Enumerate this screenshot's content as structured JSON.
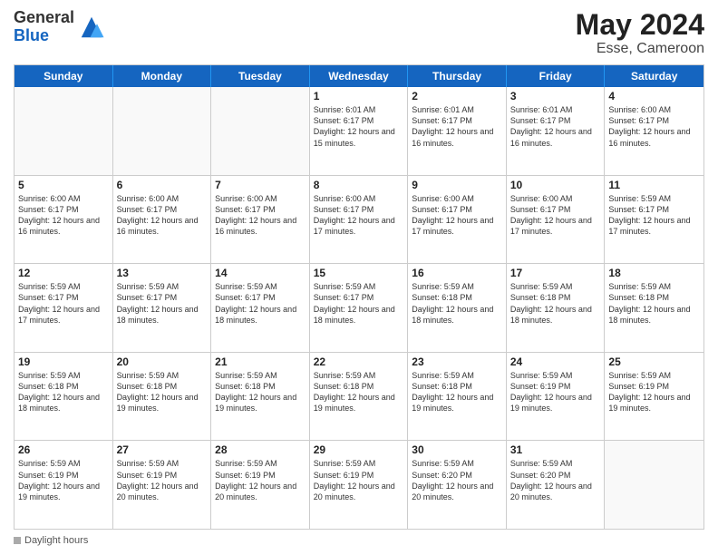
{
  "header": {
    "logo_line1": "General",
    "logo_line2": "Blue",
    "month_year": "May 2024",
    "location": "Esse, Cameroon"
  },
  "weekdays": [
    "Sunday",
    "Monday",
    "Tuesday",
    "Wednesday",
    "Thursday",
    "Friday",
    "Saturday"
  ],
  "rows": [
    [
      {
        "day": "",
        "text": "",
        "empty": true
      },
      {
        "day": "",
        "text": "",
        "empty": true
      },
      {
        "day": "",
        "text": "",
        "empty": true
      },
      {
        "day": "1",
        "text": "Sunrise: 6:01 AM\nSunset: 6:17 PM\nDaylight: 12 hours\nand 15 minutes.",
        "empty": false
      },
      {
        "day": "2",
        "text": "Sunrise: 6:01 AM\nSunset: 6:17 PM\nDaylight: 12 hours\nand 16 minutes.",
        "empty": false
      },
      {
        "day": "3",
        "text": "Sunrise: 6:01 AM\nSunset: 6:17 PM\nDaylight: 12 hours\nand 16 minutes.",
        "empty": false
      },
      {
        "day": "4",
        "text": "Sunrise: 6:00 AM\nSunset: 6:17 PM\nDaylight: 12 hours\nand 16 minutes.",
        "empty": false
      }
    ],
    [
      {
        "day": "5",
        "text": "Sunrise: 6:00 AM\nSunset: 6:17 PM\nDaylight: 12 hours\nand 16 minutes.",
        "empty": false
      },
      {
        "day": "6",
        "text": "Sunrise: 6:00 AM\nSunset: 6:17 PM\nDaylight: 12 hours\nand 16 minutes.",
        "empty": false
      },
      {
        "day": "7",
        "text": "Sunrise: 6:00 AM\nSunset: 6:17 PM\nDaylight: 12 hours\nand 16 minutes.",
        "empty": false
      },
      {
        "day": "8",
        "text": "Sunrise: 6:00 AM\nSunset: 6:17 PM\nDaylight: 12 hours\nand 17 minutes.",
        "empty": false
      },
      {
        "day": "9",
        "text": "Sunrise: 6:00 AM\nSunset: 6:17 PM\nDaylight: 12 hours\nand 17 minutes.",
        "empty": false
      },
      {
        "day": "10",
        "text": "Sunrise: 6:00 AM\nSunset: 6:17 PM\nDaylight: 12 hours\nand 17 minutes.",
        "empty": false
      },
      {
        "day": "11",
        "text": "Sunrise: 5:59 AM\nSunset: 6:17 PM\nDaylight: 12 hours\nand 17 minutes.",
        "empty": false
      }
    ],
    [
      {
        "day": "12",
        "text": "Sunrise: 5:59 AM\nSunset: 6:17 PM\nDaylight: 12 hours\nand 17 minutes.",
        "empty": false
      },
      {
        "day": "13",
        "text": "Sunrise: 5:59 AM\nSunset: 6:17 PM\nDaylight: 12 hours\nand 18 minutes.",
        "empty": false
      },
      {
        "day": "14",
        "text": "Sunrise: 5:59 AM\nSunset: 6:17 PM\nDaylight: 12 hours\nand 18 minutes.",
        "empty": false
      },
      {
        "day": "15",
        "text": "Sunrise: 5:59 AM\nSunset: 6:17 PM\nDaylight: 12 hours\nand 18 minutes.",
        "empty": false
      },
      {
        "day": "16",
        "text": "Sunrise: 5:59 AM\nSunset: 6:18 PM\nDaylight: 12 hours\nand 18 minutes.",
        "empty": false
      },
      {
        "day": "17",
        "text": "Sunrise: 5:59 AM\nSunset: 6:18 PM\nDaylight: 12 hours\nand 18 minutes.",
        "empty": false
      },
      {
        "day": "18",
        "text": "Sunrise: 5:59 AM\nSunset: 6:18 PM\nDaylight: 12 hours\nand 18 minutes.",
        "empty": false
      }
    ],
    [
      {
        "day": "19",
        "text": "Sunrise: 5:59 AM\nSunset: 6:18 PM\nDaylight: 12 hours\nand 18 minutes.",
        "empty": false
      },
      {
        "day": "20",
        "text": "Sunrise: 5:59 AM\nSunset: 6:18 PM\nDaylight: 12 hours\nand 19 minutes.",
        "empty": false
      },
      {
        "day": "21",
        "text": "Sunrise: 5:59 AM\nSunset: 6:18 PM\nDaylight: 12 hours\nand 19 minutes.",
        "empty": false
      },
      {
        "day": "22",
        "text": "Sunrise: 5:59 AM\nSunset: 6:18 PM\nDaylight: 12 hours\nand 19 minutes.",
        "empty": false
      },
      {
        "day": "23",
        "text": "Sunrise: 5:59 AM\nSunset: 6:18 PM\nDaylight: 12 hours\nand 19 minutes.",
        "empty": false
      },
      {
        "day": "24",
        "text": "Sunrise: 5:59 AM\nSunset: 6:19 PM\nDaylight: 12 hours\nand 19 minutes.",
        "empty": false
      },
      {
        "day": "25",
        "text": "Sunrise: 5:59 AM\nSunset: 6:19 PM\nDaylight: 12 hours\nand 19 minutes.",
        "empty": false
      }
    ],
    [
      {
        "day": "26",
        "text": "Sunrise: 5:59 AM\nSunset: 6:19 PM\nDaylight: 12 hours\nand 19 minutes.",
        "empty": false
      },
      {
        "day": "27",
        "text": "Sunrise: 5:59 AM\nSunset: 6:19 PM\nDaylight: 12 hours\nand 20 minutes.",
        "empty": false
      },
      {
        "day": "28",
        "text": "Sunrise: 5:59 AM\nSunset: 6:19 PM\nDaylight: 12 hours\nand 20 minutes.",
        "empty": false
      },
      {
        "day": "29",
        "text": "Sunrise: 5:59 AM\nSunset: 6:19 PM\nDaylight: 12 hours\nand 20 minutes.",
        "empty": false
      },
      {
        "day": "30",
        "text": "Sunrise: 5:59 AM\nSunset: 6:20 PM\nDaylight: 12 hours\nand 20 minutes.",
        "empty": false
      },
      {
        "day": "31",
        "text": "Sunrise: 5:59 AM\nSunset: 6:20 PM\nDaylight: 12 hours\nand 20 minutes.",
        "empty": false
      },
      {
        "day": "",
        "text": "",
        "empty": true
      }
    ]
  ],
  "footer": {
    "label": "Daylight hours"
  }
}
